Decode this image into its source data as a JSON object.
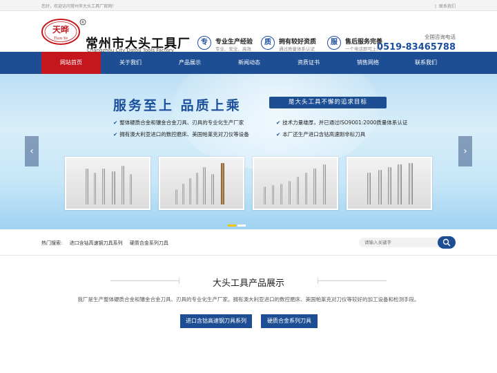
{
  "topbar": {
    "welcome": "您好，欢迎访问常州市大头工具厂官网！",
    "contact_link": "联系我们"
  },
  "header": {
    "logo_text": "天晔",
    "logo_sub": "Tian Ye",
    "company_name": "常州市大头工具厂",
    "company_en": "Changzhou City Datou Tools Factory",
    "features": [
      {
        "icon": "专",
        "title": "专业生产经验",
        "sub": "专业、安全、高效"
      },
      {
        "icon": "质",
        "title": "拥有较好资质",
        "sub": "通过质量体系认证"
      },
      {
        "icon": "服",
        "title": "售后服务完善",
        "sub": "一个电话即可上门"
      }
    ],
    "hotline_label": "全国咨询电话",
    "hotline_number": "0519-83465788"
  },
  "nav": {
    "items": [
      "网站首页",
      "关于我们",
      "产品展示",
      "新闻动态",
      "资质证书",
      "销售网络",
      "联系我们"
    ],
    "active_index": 0
  },
  "banner": {
    "slogan": "服务至上  品质上乘",
    "tag": "是大头工具不懈的追求目标",
    "bullets": [
      "整体硬质合金和镶金合金刀具、刃具的专业化生产厂家",
      "技术力量雄厚，并已通过ISO9001:2000质量体系认证",
      "拥有澳大利亚进口的数控磨床、美国帕莱克对刀仪等设备",
      "本厂还生产进口含钴高速刚非标刀具"
    ],
    "prev_glyph": "‹",
    "next_glyph": "›",
    "slide_count": 2,
    "active_slide": 0
  },
  "search": {
    "hot_label": "热门搜索:",
    "keywords": [
      "进口含钴高速钢刀具系列",
      "硬质合金系列刀具"
    ],
    "placeholder": "请输入关键字"
  },
  "products": {
    "title": "大头工具产品展示",
    "description": "我厂是生产整体硬质合金和镶金合金刀具、刃具的专业化生产厂家。拥有澳大利亚进口的数控磨床、美国帕莱克对刀仪等较好的加工设备和检测手段。",
    "categories": [
      "进口含钴高速钢刀具系列",
      "硬质合金系列刀具"
    ]
  },
  "colors": {
    "brand_blue": "#1d4e93",
    "active_red": "#c4161c",
    "accent_yellow": "#f3c300"
  }
}
